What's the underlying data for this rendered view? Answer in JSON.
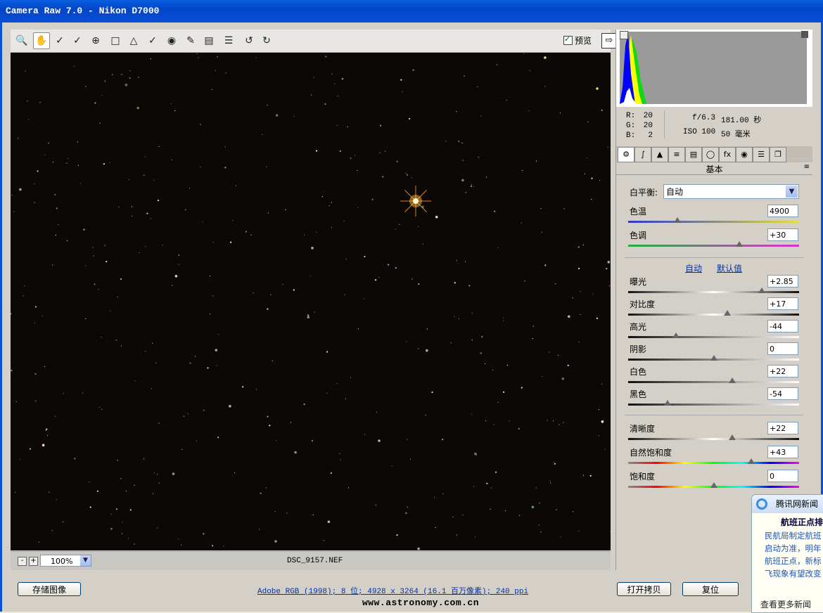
{
  "window": {
    "title": "Camera Raw 7.0 -  Nikon D7000"
  },
  "toolbar": {
    "tools": [
      "zoom-icon",
      "hand-icon",
      "white-balance-icon",
      "color-sampler-icon",
      "target-adjust-icon",
      "crop-icon",
      "straighten-icon",
      "spot-removal-icon",
      "red-eye-icon",
      "adjustment-brush-icon",
      "graduated-filter-icon",
      "preferences-icon",
      "rotate-left-icon",
      "rotate-right-icon"
    ],
    "preview_label": "预览",
    "preview_checked": true
  },
  "status": {
    "zoom": "100%",
    "filename": "DSC_9157.NEF"
  },
  "info": {
    "r_label": "R:",
    "r": "20",
    "g_label": "G:",
    "g": "20",
    "b_label": "B:",
    "b": "2",
    "aperture": "f/6.3",
    "shutter": "181.00 秒",
    "iso": "ISO 100",
    "focal": "50 毫米"
  },
  "panel": {
    "title": "基本",
    "wb_label": "白平衡:",
    "wb_value": "自动",
    "auto_link": "自动",
    "default_link": "默认值",
    "controls": [
      {
        "label": "色温",
        "value": "4900",
        "pos": 0.29
      },
      {
        "label": "色调",
        "value": "+30",
        "pos": 0.65
      },
      {
        "label": "曝光",
        "value": "+2.85",
        "pos": 0.78
      },
      {
        "label": "对比度",
        "value": "+17",
        "pos": 0.58
      },
      {
        "label": "高光",
        "value": "-44",
        "pos": 0.28
      },
      {
        "label": "阴影",
        "value": "0",
        "pos": 0.5
      },
      {
        "label": "白色",
        "value": "+22",
        "pos": 0.61
      },
      {
        "label": "黑色",
        "value": "-54",
        "pos": 0.23
      },
      {
        "label": "清晰度",
        "value": "+22",
        "pos": 0.61
      },
      {
        "label": "自然饱和度",
        "value": "+43",
        "pos": 0.72
      },
      {
        "label": "饱和度",
        "value": "0",
        "pos": 0.5
      }
    ]
  },
  "bottom": {
    "save_label": "存储图像",
    "info_text": "Adobe RGB (1998); 8 位; 4928 x 3264 (16.1 百万像素); 240 ppi",
    "open_copy_label": "打开拷贝",
    "reset_label": "复位"
  },
  "watermark": "www.astronomy.com.cn",
  "news": {
    "header": "腾讯网新闻",
    "headline": "航班正点排",
    "body": "民航局制定航班\n启动为准，明年\n航班正点，新标\n飞现象有望改变",
    "more": "查看更多新闻"
  },
  "colors": {
    "title_bar": "#0345c8",
    "canvas_bg": "#0b0805",
    "star": "#ffb640"
  }
}
